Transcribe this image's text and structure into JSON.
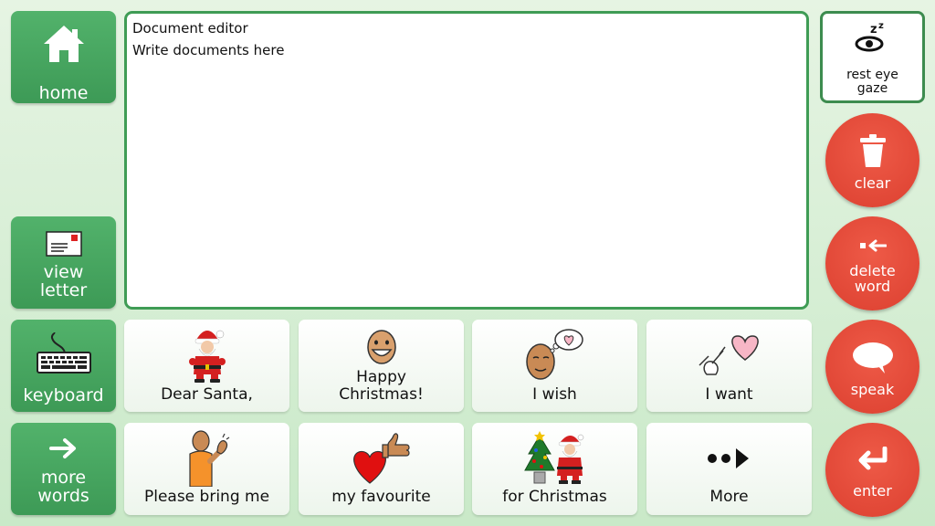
{
  "left_column": {
    "home": "home",
    "view_letter": [
      "view",
      "letter"
    ],
    "keyboard": "keyboard",
    "more_words": [
      "more",
      "words"
    ]
  },
  "editor": {
    "lines": [
      "Document editor",
      "Write documents here"
    ]
  },
  "right_column": {
    "rest_eye_gaze": [
      "rest eye",
      "gaze"
    ],
    "clear": "clear",
    "delete_word": [
      "delete",
      "word"
    ],
    "speak": "speak",
    "enter": "enter"
  },
  "phrases": [
    {
      "label": [
        "Dear Santa,"
      ],
      "icon": "santa-icon"
    },
    {
      "label": [
        "Happy",
        "Christmas!"
      ],
      "icon": "happy-face-icon"
    },
    {
      "label": [
        "I wish"
      ],
      "icon": "wish-icon"
    },
    {
      "label": [
        "I want"
      ],
      "icon": "want-icon"
    },
    {
      "label": [
        "Please bring me"
      ],
      "icon": "bring-icon"
    },
    {
      "label": [
        "my favourite"
      ],
      "icon": "favourite-icon"
    },
    {
      "label": [
        "for Christmas"
      ],
      "icon": "christmas-icon"
    },
    {
      "label": [
        "More"
      ],
      "icon": "more-icon"
    }
  ],
  "colors": {
    "green_tile": "#46a55f",
    "red_button": "#e24a38",
    "background": "#d8eed6"
  }
}
